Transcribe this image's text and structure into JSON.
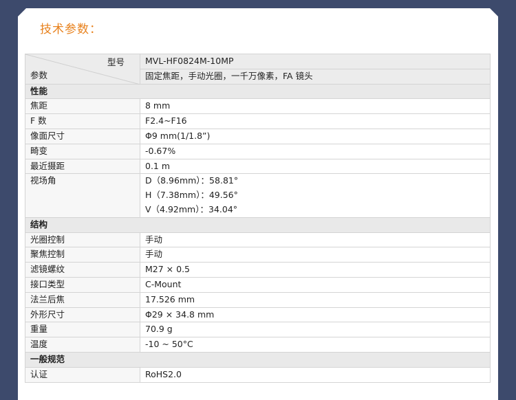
{
  "title": "技术参数：",
  "header": {
    "model_label": "型号",
    "param_label": "参数",
    "model_value": "MVL-HF0824M-10MP",
    "desc_value": "固定焦距，手动光圈，一千万像素，FA 镜头"
  },
  "sections": [
    {
      "name": "性能"
    },
    {
      "name": "结构"
    },
    {
      "name": "一般规范"
    }
  ],
  "rows": {
    "focal": {
      "label": "焦距",
      "value": "8 mm"
    },
    "fnum": {
      "label": "F 数",
      "value": "F2.4~F16"
    },
    "imgsize": {
      "label": "像面尺寸",
      "value": "Φ9 mm(1/1.8”)"
    },
    "distortion": {
      "label": "畸变",
      "value": "-0.67%"
    },
    "mindist": {
      "label": "最近摄距",
      "value": "0.1 m"
    },
    "fov": {
      "label": "视场角",
      "d": "D（8.96mm）：58.81°",
      "h": "H（7.38mm）：49.56°",
      "v": "V（4.92mm）：34.04°"
    },
    "iris": {
      "label": "光圈控制",
      "value": "手动"
    },
    "focus": {
      "label": "聚焦控制",
      "value": "手动"
    },
    "filter": {
      "label": "滤镜螺纹",
      "value": "M27 × 0.5"
    },
    "mount": {
      "label": "接口类型",
      "value": "C-Mount"
    },
    "flange": {
      "label": "法兰后焦",
      "value": "17.526 mm"
    },
    "dims": {
      "label": "外形尺寸",
      "value": "Φ29 × 34.8 mm"
    },
    "weight": {
      "label": "重量",
      "value": "70.9 g"
    },
    "temp": {
      "label": "温度",
      "value": "-10 ~ 50°C"
    },
    "cert": {
      "label": "认证",
      "value": "RoHS2.0"
    }
  }
}
